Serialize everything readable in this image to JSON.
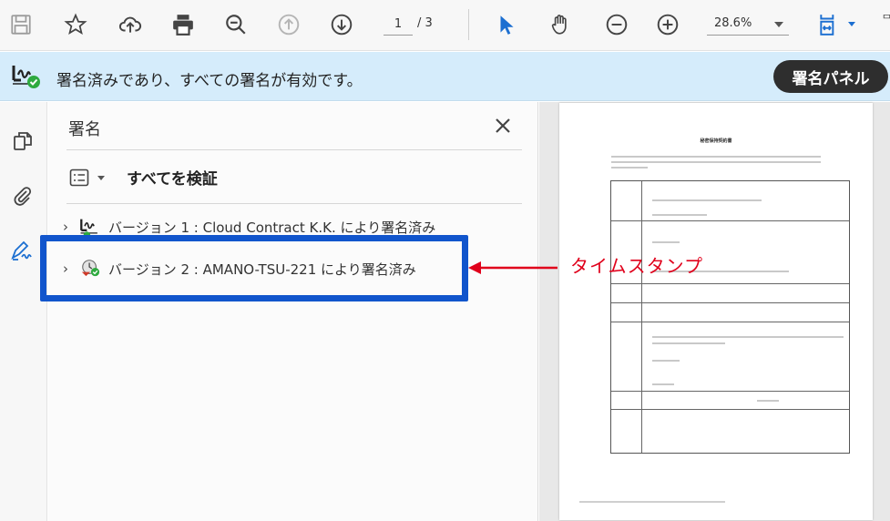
{
  "toolbar": {
    "page_current": "1",
    "page_total": "/ 3",
    "zoom_value": "28.6%",
    "edge_glyph": "ᄆ"
  },
  "status_bar": {
    "message": "署名済みであり、すべての署名が有効です。",
    "panel_button": "署名パネル"
  },
  "signatures_panel": {
    "title": "署名",
    "verify_all": "すべてを検証",
    "versions": [
      {
        "label": "バージョン 1 : Cloud Contract K.K. により署名済み"
      },
      {
        "label": "バージョン 2 : AMANO-TSU-221 により署名済み"
      }
    ]
  },
  "annotation": {
    "text": "タイムスタンプ",
    "color": "#e0001b",
    "highlight_color": "#1155cc"
  },
  "document": {
    "title": "秘密保持契約書"
  },
  "colors": {
    "accent": "#1c6fd1",
    "sigbar_bg": "#d5ecfb",
    "valid_green": "#2eaa3f"
  }
}
